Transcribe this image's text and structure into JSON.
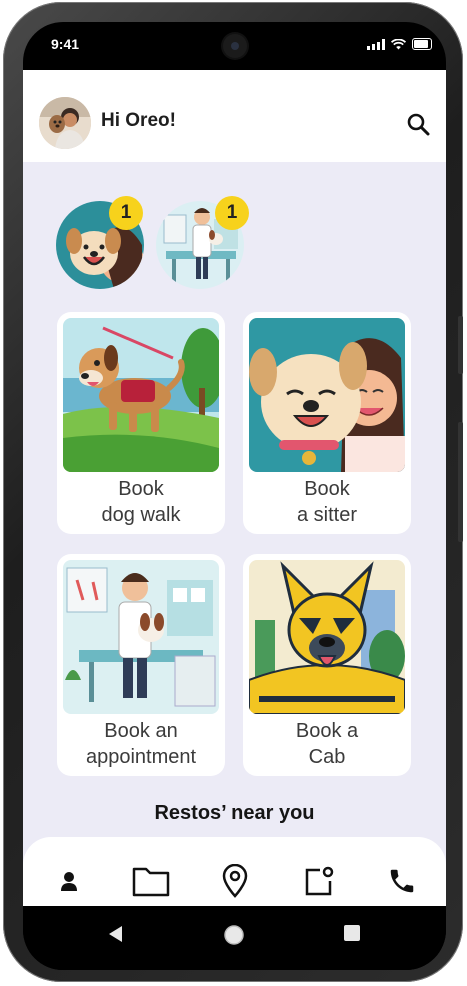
{
  "status_bar": {
    "time": "9:41"
  },
  "header": {
    "greeting": "Hi Oreo!"
  },
  "stories": [
    {
      "name": "story-dog-with-girl",
      "badge": "1"
    },
    {
      "name": "story-vet",
      "badge": "1"
    }
  ],
  "services": [
    {
      "line1": "Book",
      "line2": "dog walk"
    },
    {
      "line1": "Book",
      "line2": "a sitter"
    },
    {
      "line1": "Book an",
      "line2": "appointment"
    },
    {
      "line1": "Book a",
      "line2": "Cab"
    }
  ],
  "section": {
    "title": "Restos’ near you"
  },
  "bottom_nav": [
    "profile-icon",
    "folder-icon",
    "location-pin-icon",
    "notification-icon",
    "phone-icon"
  ],
  "system_nav": [
    "back-icon",
    "home-icon",
    "recents-icon"
  ],
  "colors": {
    "background": "#ecebf6",
    "badge": "#f7d21c",
    "card": "#ffffff"
  }
}
